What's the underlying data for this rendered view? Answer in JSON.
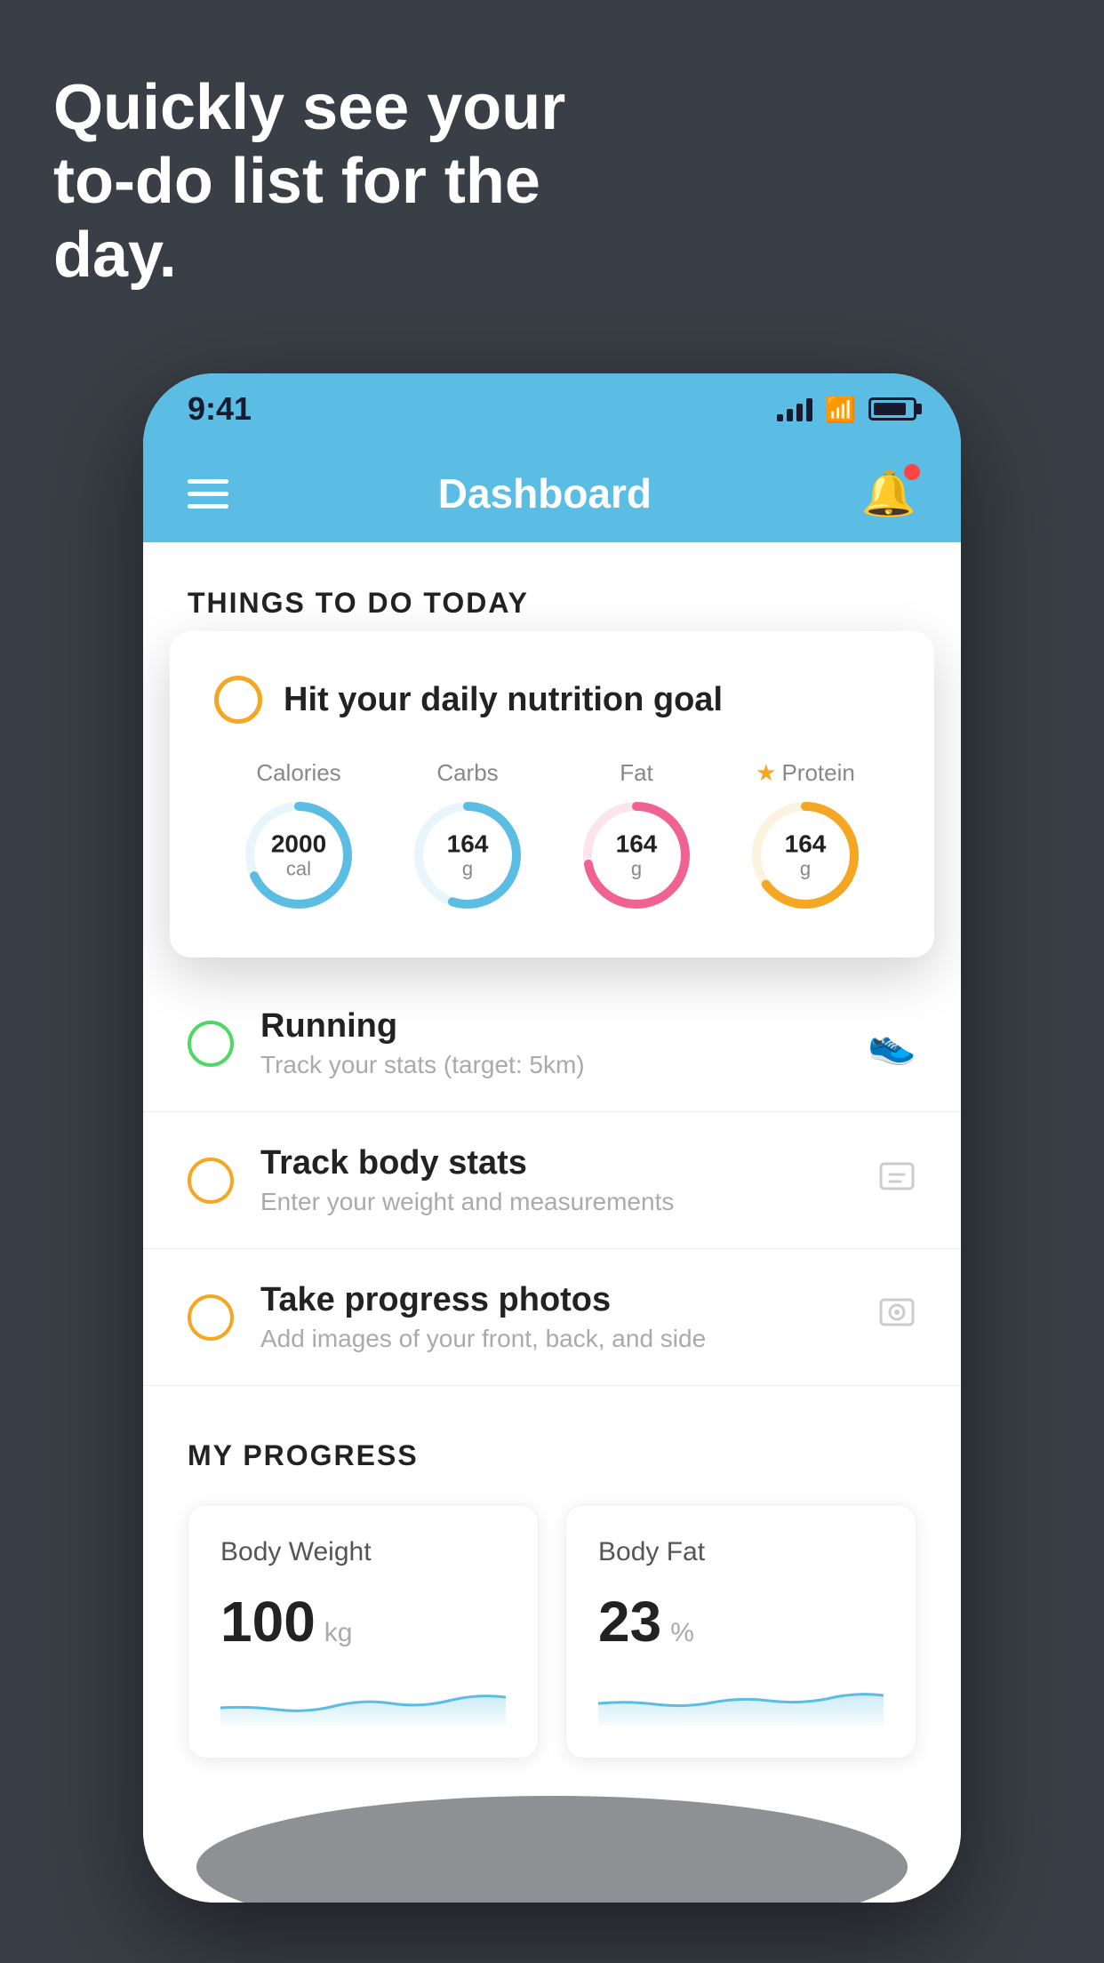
{
  "hero": {
    "title": "Quickly see your to-do list for the day."
  },
  "phone": {
    "statusBar": {
      "time": "9:41"
    },
    "navBar": {
      "title": "Dashboard"
    },
    "content": {
      "sectionHeader": "THINGS TO DO TODAY",
      "floatingCard": {
        "radioColor": "orange",
        "title": "Hit your daily nutrition goal",
        "rings": [
          {
            "label": "Calories",
            "value": "2000",
            "unit": "cal",
            "color": "#5bbde4",
            "bgColor": "#e8f6fc",
            "percentage": 68,
            "circumference": 345
          },
          {
            "label": "Carbs",
            "value": "164",
            "unit": "g",
            "color": "#5bbde4",
            "bgColor": "#e8f6fc",
            "percentage": 55,
            "circumference": 345
          },
          {
            "label": "Fat",
            "value": "164",
            "unit": "g",
            "color": "#f06292",
            "bgColor": "#fce4ec",
            "percentage": 72,
            "circumference": 345
          },
          {
            "label": "Protein",
            "value": "164",
            "unit": "g",
            "color": "#f5a623",
            "bgColor": "#fef3e0",
            "percentage": 65,
            "circumference": 345,
            "hasStar": true
          }
        ]
      },
      "todoItems": [
        {
          "radioColor": "green",
          "title": "Running",
          "subtitle": "Track your stats (target: 5km)",
          "icon": "👟"
        },
        {
          "radioColor": "orange",
          "title": "Track body stats",
          "subtitle": "Enter your weight and measurements",
          "icon": "⚖️"
        },
        {
          "radioColor": "orange",
          "title": "Take progress photos",
          "subtitle": "Add images of your front, back, and side",
          "icon": "🖼️"
        }
      ],
      "myProgress": {
        "header": "MY PROGRESS",
        "cards": [
          {
            "title": "Body Weight",
            "value": "100",
            "unit": "kg"
          },
          {
            "title": "Body Fat",
            "value": "23",
            "unit": "%"
          }
        ]
      }
    }
  }
}
